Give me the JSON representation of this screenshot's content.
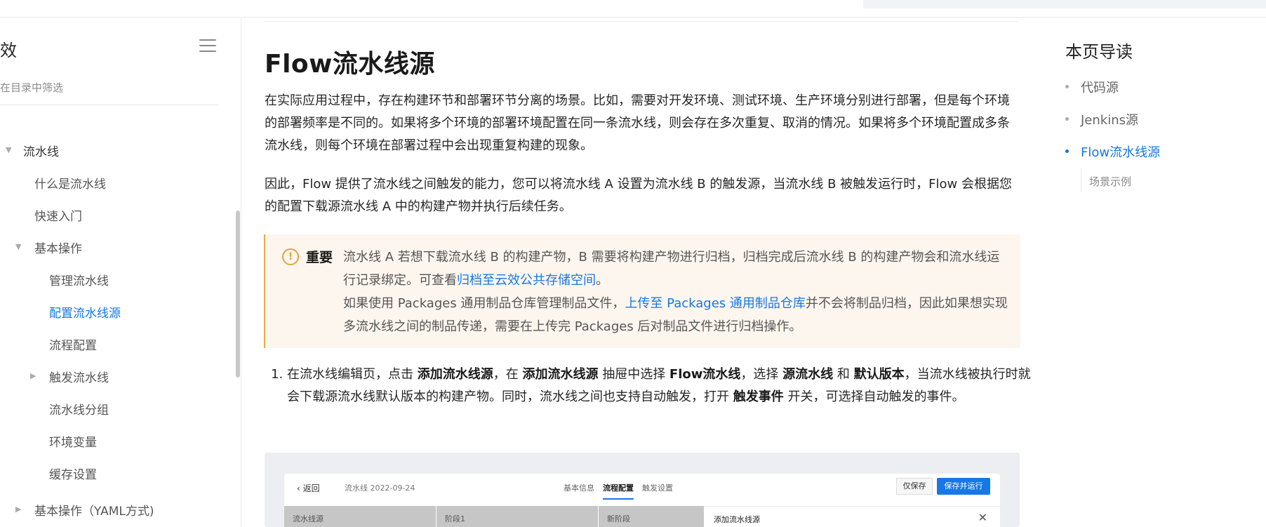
{
  "sidebar": {
    "title": "效",
    "filter_placeholder": "在目录中筛选",
    "items": [
      {
        "label": "流水线"
      },
      {
        "label": "什么是流水线"
      },
      {
        "label": "快速入门"
      },
      {
        "label": "基本操作"
      },
      {
        "label": "管理流水线"
      },
      {
        "label": "配置流水线源"
      },
      {
        "label": "流程配置"
      },
      {
        "label": "触发流水线"
      },
      {
        "label": "流水线分组"
      },
      {
        "label": "环境变量"
      },
      {
        "label": "缓存设置"
      },
      {
        "label": "基本操作（YAML方式)"
      }
    ]
  },
  "main": {
    "title": "Flow流水线源",
    "para1": "在实际应用过程中，存在构建环节和部署环节分离的场景。比如，需要对开发环境、测试环境、生产环境分别进行部署，但是每个环境的部署频率是不同的。如果将多个环境的部署环境配置在同一条流水线，则会存在多次重复、取消的情况。如果将多个环境配置成多条流水线，则每个环境在部署过程中会出现重复构建的现象。",
    "para2": "因此，Flow 提供了流水线之间触发的能力，您可以将流水线 A 设置为流水线 B 的触发源，当流水线 B 被触发运行时，Flow 会根据您的配置下载源流水线 A 中的构建产物并执行后续任务。",
    "notice": {
      "label": "重要",
      "line1_pre": "流水线 A 若想下载流水线 B 的构建产物，B 需要将构建产物进行归档，归档完成后流水线 B 的构建产物会和流水线运行记录绑定。可查看",
      "line1_link": "归档至云效公共存储空间",
      "line1_post": "。",
      "line2_pre": "如果使用 Packages 通用制品仓库管理制品文件，",
      "line2_link": "上传至 Packages 通用制品仓库",
      "line2_post": "并不会将制品归档，因此如果想实现多流水线之间的制品传递，需要在上传完 Packages 后对制品文件进行归档操作。"
    },
    "step1": {
      "t1": "在流水线编辑页，点击 ",
      "b1": "添加流水线源",
      "t2": "，在 ",
      "b2": "添加流水线源",
      "t3": " 抽屉中选择 ",
      "b3": "Flow流水线",
      "t4": "，选择 ",
      "b4": "源流水线",
      "t5": " 和 ",
      "b5": "默认版本",
      "t6": "，当流水线被执行时就会下载源流水线默认版本的构建产物。同时，流水线之间也支持自动触发，打开 ",
      "b6": "触发事件",
      "t7": " 开关，可选择自动触发的事件。"
    },
    "screenshot": {
      "back": "返回",
      "pipeline_name": "流水线 2022-09-24",
      "tabs": [
        "基本信息",
        "流程配置",
        "触发设置"
      ],
      "save": "仅保存",
      "save_run": "保存并运行",
      "lane1": "流水线源",
      "lane2": "阶段1",
      "lane3": "新阶段",
      "drawer_title": "添加流水线源"
    }
  },
  "toc": {
    "title": "本页导读",
    "items": [
      {
        "label": "代码源"
      },
      {
        "label": "Jenkins源"
      },
      {
        "label": "Flow流水线源"
      }
    ],
    "sub": "场景示例"
  },
  "colors": {
    "accent": "#1677e6",
    "notice_bg": "#fdf6ee",
    "warning": "#e9a13b"
  }
}
